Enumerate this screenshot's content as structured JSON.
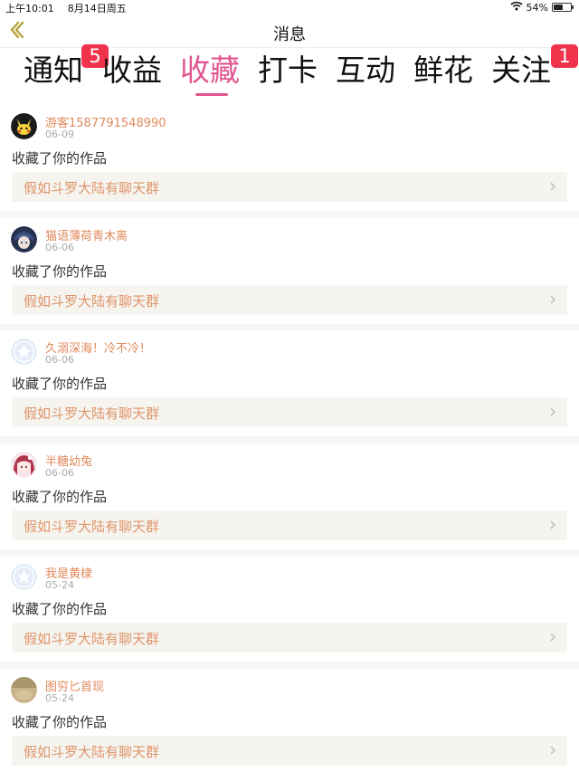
{
  "status_bar": {
    "time": "上午10:01",
    "date": "8月14日周五",
    "battery": "54%",
    "battery_level": 0.54,
    "icons": [
      "wifi-icon",
      "battery-icon"
    ]
  },
  "nav": {
    "title": "消息",
    "back_icon": "chevron-left-icon"
  },
  "tabs": [
    {
      "label": "通知",
      "badge": "5"
    },
    {
      "label": "收益"
    },
    {
      "label": "收藏",
      "active": true
    },
    {
      "label": "打卡"
    },
    {
      "label": "互动"
    },
    {
      "label": "鲜花"
    },
    {
      "label": "关注",
      "badge": "1"
    }
  ],
  "colors": {
    "accent": "#e05590",
    "badge": "#f0334b",
    "username": "#e08a5c",
    "work_title": "#e0956a",
    "link_background": "#f5f4ef"
  },
  "feed": [
    {
      "avatar": "pikachu-avatar",
      "username": "游客1587791548990",
      "date": "06-09",
      "action": "收藏了你的作品",
      "work_title": "假如斗罗大陆有聊天群"
    },
    {
      "avatar": "anime-boy-avatar",
      "username": "猫语薄荷青木离",
      "date": "06-06",
      "action": "收藏了你的作品",
      "work_title": "假如斗罗大陆有聊天群"
    },
    {
      "avatar": "default-star-avatar",
      "username": "久溺深海！冷不冷！",
      "date": "06-06",
      "action": "收藏了你的作品",
      "work_title": "假如斗罗大陆有聊天群"
    },
    {
      "avatar": "anime-girl-avatar",
      "username": "半糖幼兔",
      "date": "06-06",
      "action": "收藏了你的作品",
      "work_title": "假如斗罗大陆有聊天群"
    },
    {
      "avatar": "default-star-avatar",
      "username": "我是黄棣",
      "date": "05-24",
      "action": "收藏了你的作品",
      "work_title": "假如斗罗大陆有聊天群"
    },
    {
      "avatar": "photo-avatar",
      "username": "图穷匕首现",
      "date": "05-24",
      "action": "收藏了你的作品",
      "work_title": "假如斗罗大陆有聊天群"
    }
  ]
}
